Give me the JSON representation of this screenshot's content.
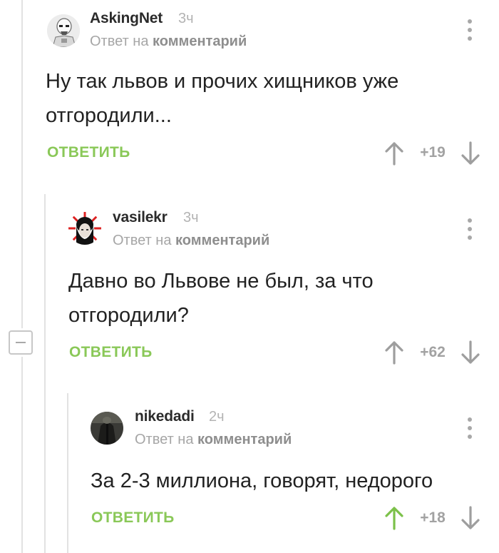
{
  "comments": [
    {
      "author": "AskingNet",
      "time": "3ч",
      "reply_prefix": "Ответ на",
      "reply_link": "комментарий",
      "text_line1": "Ну так львов и прочих хищников уже",
      "text_line2": "отгородили...",
      "reply_label": "ОТВЕТИТЬ",
      "score": "+19"
    },
    {
      "author": "vasilekr",
      "time": "3ч",
      "reply_prefix": "Ответ на",
      "reply_link": "комментарий",
      "text_line1": "Давно во Львове не был, за что",
      "text_line2": "отгородили?",
      "reply_label": "ОТВЕТИТЬ",
      "score": "+62"
    },
    {
      "author": "nikedadi",
      "time": "2ч",
      "reply_prefix": "Ответ на",
      "reply_link": "комментарий",
      "text_line1": "За 2-3 миллиона, говорят, недорого",
      "reply_label": "ОТВЕТИТЬ",
      "score": "+18"
    }
  ],
  "colors": {
    "accent_green": "#8ac858",
    "upvote_active": "#7cc14a",
    "vote_inactive": "#9e9e9e"
  }
}
